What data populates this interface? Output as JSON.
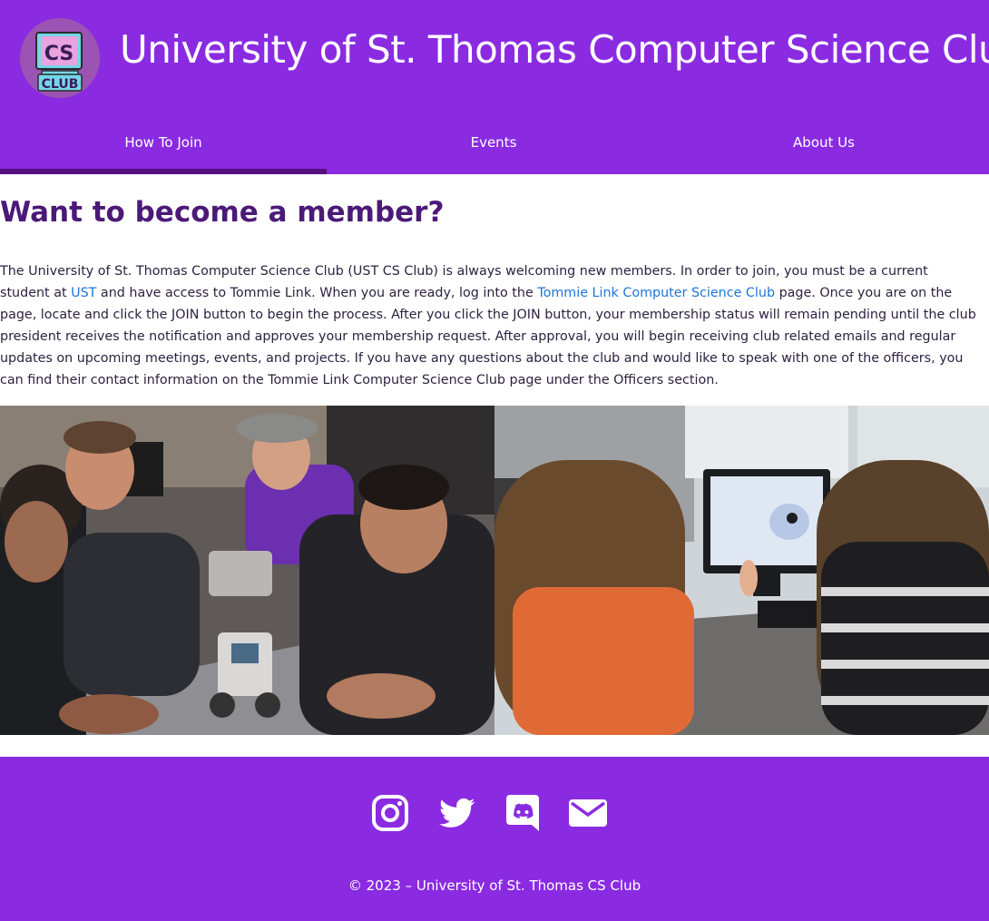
{
  "header": {
    "title": "University of St. Thomas Computer Science Club",
    "logo_text_top": "CS",
    "logo_text_bottom": "CLUB"
  },
  "nav": {
    "tabs": [
      {
        "label": "How To Join",
        "active": true
      },
      {
        "label": "Events",
        "active": false
      },
      {
        "label": "About Us",
        "active": false
      }
    ]
  },
  "main": {
    "heading": "Want to become a member?",
    "paragraph": {
      "part1": "The University of St. Thomas Computer Science Club (UST CS Club) is always welcoming new members. In order to join, you must be a current student at ",
      "link_ust": "UST",
      "part2": " and have access to Tommie Link. When you are ready, log into the ",
      "link_tommie": "Tommie Link Computer Science Club",
      "part3": " page. Once you are on the page, locate and click the JOIN button to begin the process. After you click the JOIN button, your membership status will remain pending until the club president receives the notification and approves your membership request. After approval, you will begin receiving club related emails and regular updates on upcoming meetings, events, and projects. If you have any questions about the club and would like to speak with one of the officers, you can find their contact information on the Tommie Link Computer Science Club page under the Officers section."
    }
  },
  "footer": {
    "social": [
      "instagram-icon",
      "twitter-icon",
      "discord-icon",
      "email-icon"
    ],
    "copyright": "© 2023 – University of St. Thomas CS Club"
  },
  "colors": {
    "brand_purple": "#8a2be2",
    "heading_purple": "#4b1a78",
    "link_blue": "#1c74d9",
    "active_tab_underline": "#57107f"
  }
}
